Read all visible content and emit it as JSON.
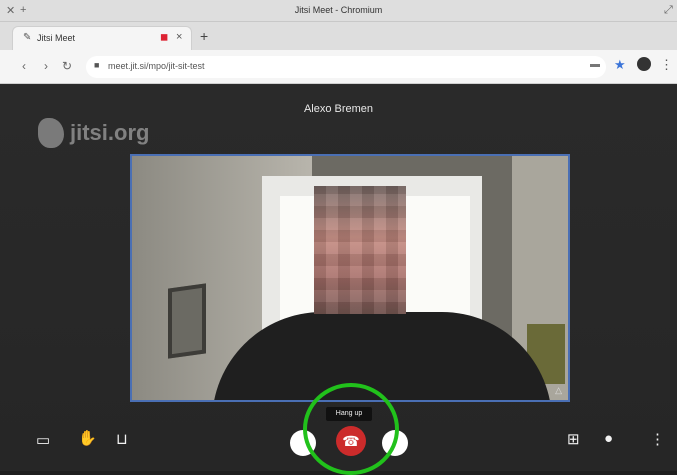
{
  "browser": {
    "window_title": "Jitsi Meet - Chromium",
    "tab_title": "Jitsi Meet",
    "url": "meet.jit.si/mpo/jit-sit-test",
    "accent": "#3a74d8"
  },
  "conference": {
    "participant_name": "Alexo Bremen",
    "logo_text": "jitsi.org",
    "hangup_tooltip": "Hang up",
    "colors": {
      "hangup": "#cc2b2b",
      "video_border": "#4a6fb4",
      "annotation": "#21c11b"
    }
  },
  "toolbar_icons": [
    "screen-share-icon",
    "raise-hand-icon",
    "chat-icon",
    "microphone-icon",
    "hangup-icon",
    "camera-icon",
    "tile-view-icon",
    "record-icon",
    "more-options-icon"
  ]
}
